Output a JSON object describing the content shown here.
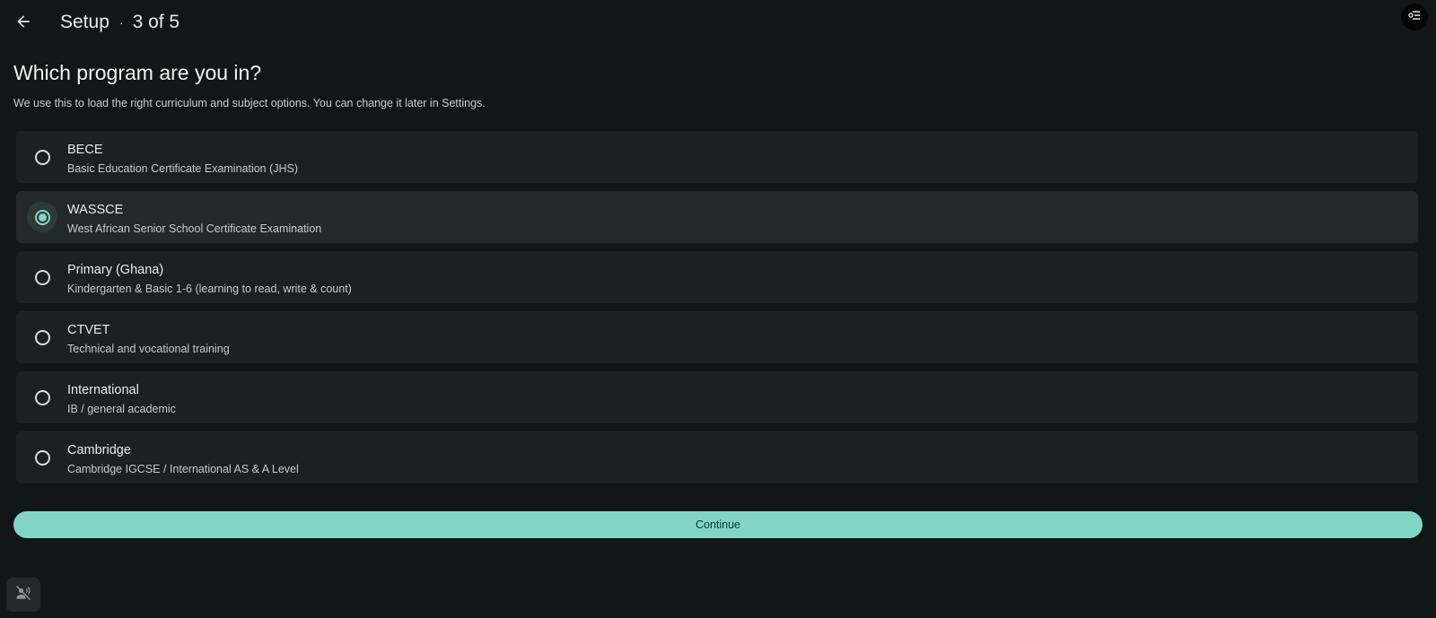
{
  "header": {
    "title": "Setup",
    "separator": "·",
    "step": "3 of 5",
    "back_icon": "arrow-left-icon",
    "menu_icon": "tune-menu-icon"
  },
  "main": {
    "heading": "Which program are you in?",
    "subheading": "We use this to load the right curriculum and subject options. You can change it later in Settings."
  },
  "options": [
    {
      "title": "BECE",
      "description": "Basic Education Certificate Examination (JHS)",
      "selected": false
    },
    {
      "title": "WASSCE",
      "description": "West African Senior School Certificate Examination",
      "selected": true
    },
    {
      "title": "Primary (Ghana)",
      "description": "Kindergarten & Basic 1-6 (learning to read, write & count)",
      "selected": false
    },
    {
      "title": "CTVET",
      "description": "Technical and vocational training",
      "selected": false
    },
    {
      "title": "International",
      "description": "IB / general academic",
      "selected": false
    },
    {
      "title": "Cambridge",
      "description": "Cambridge IGCSE / International AS & A Level",
      "selected": false
    }
  ],
  "footer": {
    "continue_label": "Continue",
    "mute_icon": "voice-off-icon"
  },
  "colors": {
    "background": "#111716",
    "card": "#1a2120",
    "card_selected": "#222a29",
    "accent": "#80d5c7"
  }
}
